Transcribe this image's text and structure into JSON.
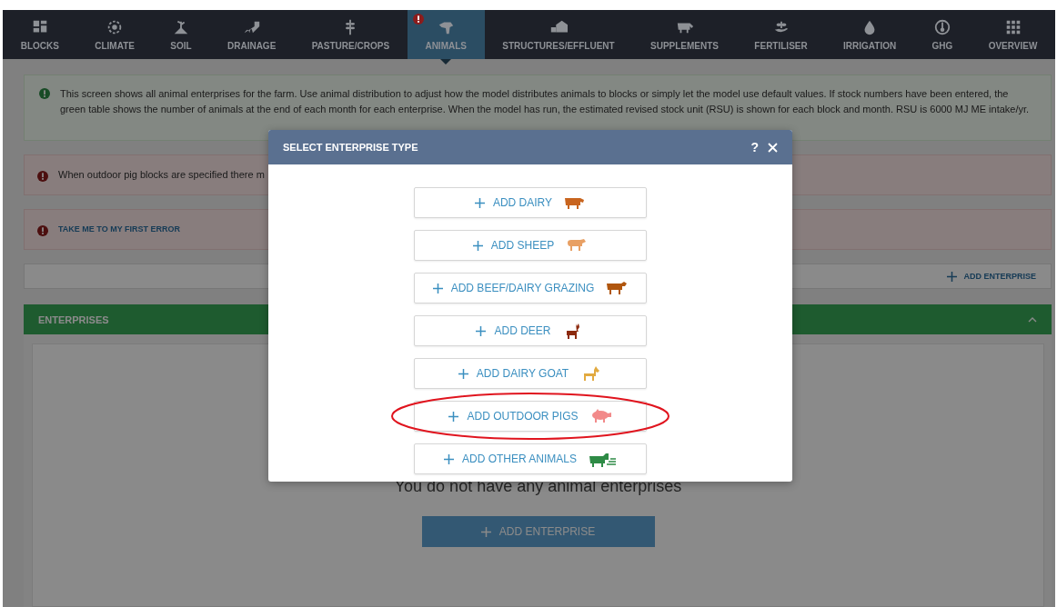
{
  "nav": {
    "tabs": [
      {
        "label": "BLOCKS",
        "selected": false,
        "error": false
      },
      {
        "label": "CLIMATE",
        "selected": false,
        "error": false
      },
      {
        "label": "SOIL",
        "selected": false,
        "error": false
      },
      {
        "label": "DRAINAGE",
        "selected": false,
        "error": false
      },
      {
        "label": "PASTURE/CROPS",
        "selected": false,
        "error": false
      },
      {
        "label": "ANIMALS",
        "selected": true,
        "error": true
      },
      {
        "label": "STRUCTURES/EFFLUENT",
        "selected": false,
        "error": false
      },
      {
        "label": "SUPPLEMENTS",
        "selected": false,
        "error": false
      },
      {
        "label": "FERTILISER",
        "selected": false,
        "error": false
      },
      {
        "label": "IRRIGATION",
        "selected": false,
        "error": false
      },
      {
        "label": "GHG",
        "selected": false,
        "error": false
      },
      {
        "label": "OVERVIEW",
        "selected": false,
        "error": false
      }
    ]
  },
  "alerts": [
    {
      "kind": "info",
      "text": "This screen shows all animal enterprises for the farm. Use animal distribution to adjust how the model distributes animals to blocks or simply let the model use default values. If stock numbers have been entered, the green table shows the number of animals at the end of each month for each enterprise. When the model has run, the estimated revised stock unit (RSU) is shown for each block and month. RSU is 6000 MJ ME intake/yr."
    },
    {
      "kind": "error",
      "text": "When outdoor pig blocks are specified there m"
    },
    {
      "kind": "link",
      "text": "TAKE ME TO MY FIRST ERROR"
    }
  ],
  "toolbar": {
    "add_link": "ADD ENTERPRISE"
  },
  "enterprises_panel": {
    "title": "ENTERPRISES",
    "expanded": true,
    "empty_message": "You do not have any animal enterprises",
    "add_button": "ADD ENTERPRISE"
  },
  "modal": {
    "title": "SELECT ENTERPRISE TYPE",
    "help": "?",
    "options": [
      {
        "label": "ADD DAIRY",
        "color": "#c8641e",
        "highlighted": false
      },
      {
        "label": "ADD SHEEP",
        "color": "#e8a064",
        "highlighted": false
      },
      {
        "label": "ADD BEEF/DAIRY GRAZING",
        "color": "#b0560e",
        "highlighted": false
      },
      {
        "label": "ADD DEER",
        "color": "#8c2a0e",
        "highlighted": false
      },
      {
        "label": "ADD DAIRY GOAT",
        "color": "#e2aa40",
        "highlighted": false
      },
      {
        "label": "ADD OUTDOOR PIGS",
        "color": "#f28a8a",
        "highlighted": true
      },
      {
        "label": "ADD OTHER ANIMALS",
        "color": "#2e8b46",
        "highlighted": false
      }
    ]
  }
}
